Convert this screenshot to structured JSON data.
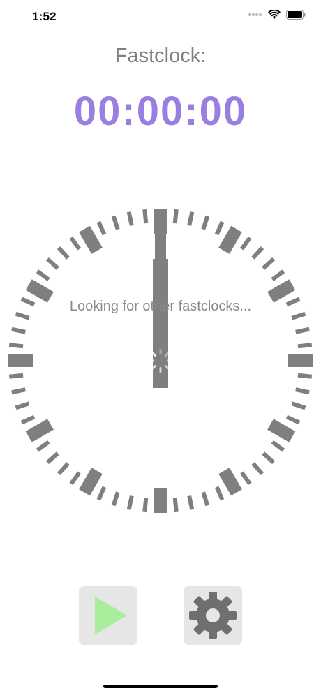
{
  "status_bar": {
    "time": "1:52",
    "icons": [
      "cellular-dots-icon",
      "wifi-icon",
      "battery-icon"
    ]
  },
  "header": {
    "title": "Fastclock:",
    "timer": "00:00:00"
  },
  "clock": {
    "hour_hand_value": 12,
    "minute_hand_value": 0,
    "status_text": "Looking for other fastclocks..."
  },
  "controls": {
    "play_icon": "play-icon",
    "settings_icon": "gear-icon"
  },
  "colors": {
    "timer": "#9b7fe0",
    "title": "#7f7f7f",
    "ticks": "#7f7f7f",
    "play": "#a9ec9a",
    "button_bg": "#e6e6e6"
  }
}
